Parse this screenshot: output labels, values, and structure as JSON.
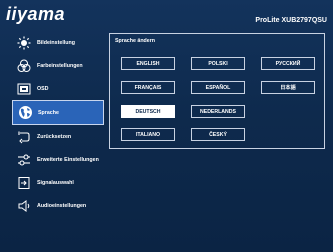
{
  "header": {
    "brand": "iiyama",
    "model": "ProLite XUB2797QSU"
  },
  "sidebar": {
    "items": [
      {
        "label": "Bildeinstellung",
        "icon": "sun-icon"
      },
      {
        "label": "Farbeinstellungen",
        "icon": "color-circles-icon"
      },
      {
        "label": "OSD",
        "icon": "osd-icon"
      },
      {
        "label": "Sprache",
        "icon": "globe-icon",
        "active": true
      },
      {
        "label": "Zurücksetzen",
        "icon": "reset-icon"
      },
      {
        "label": "Erweiterte Einstellungen",
        "icon": "sliders-icon"
      },
      {
        "label": "Signalauswahl",
        "icon": "input-icon"
      },
      {
        "label": "Audioeinstellungen",
        "icon": "speaker-icon"
      }
    ]
  },
  "content": {
    "title": "Sprache ändern",
    "languages": [
      "ENGLISH",
      "POLSKI",
      "РУССКИЙ",
      "FRANÇAIS",
      "ESPAÑOL",
      "日本語",
      "DEUTSCH",
      "NEDERLANDS",
      "ITALIANO",
      "ČESKÝ"
    ],
    "selected": "DEUTSCH"
  }
}
